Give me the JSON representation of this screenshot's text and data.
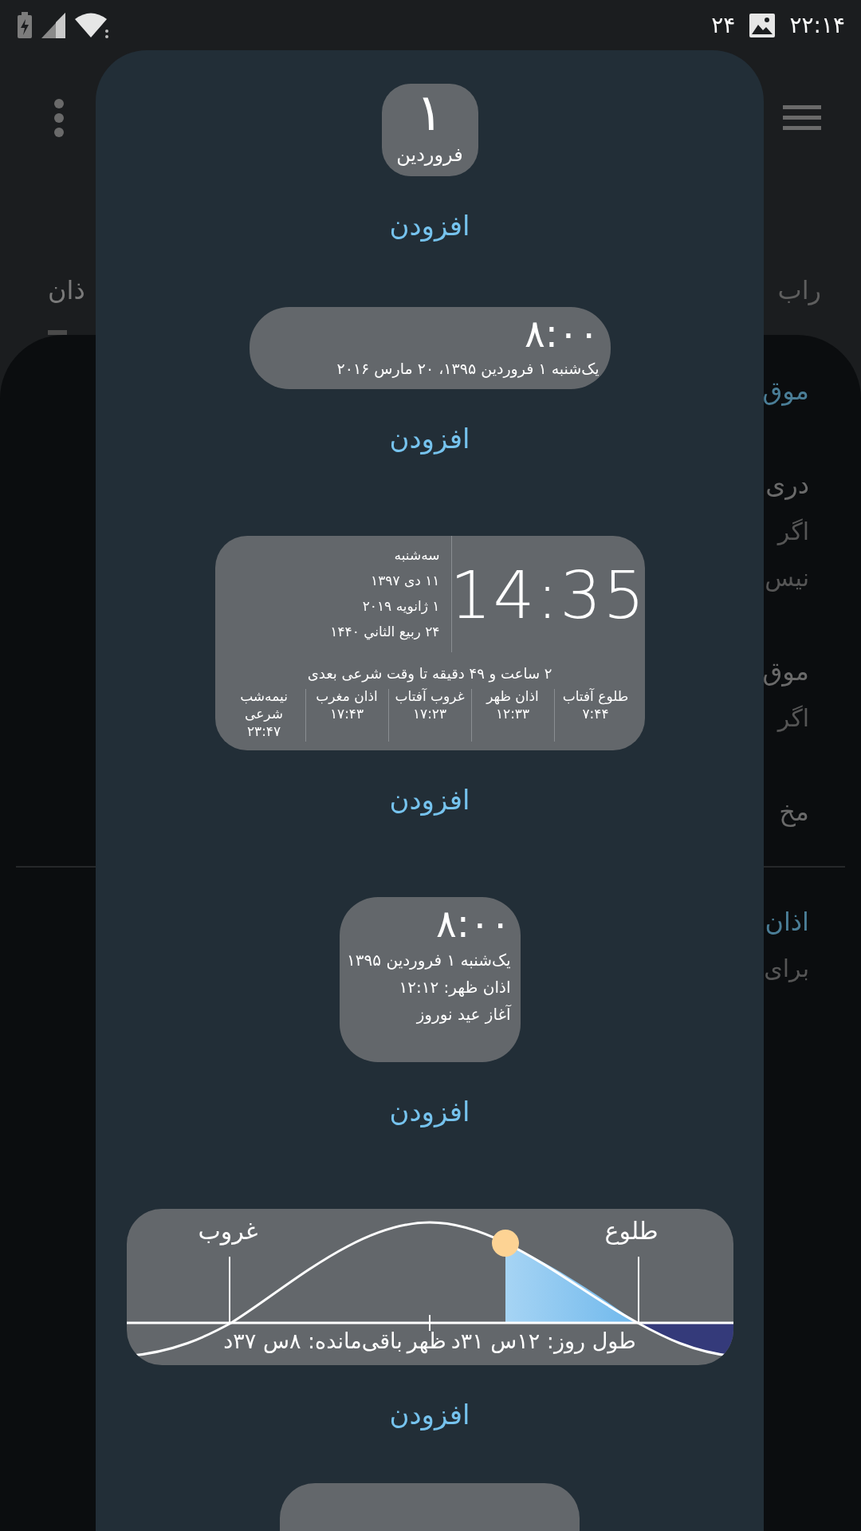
{
  "status_bar": {
    "time": "۲۲:۱۴",
    "date": "۲۴"
  },
  "background": {
    "tabs": [
      {
        "label": "راب",
        "selected": false
      },
      {
        "label": "ذان",
        "selected": true
      }
    ],
    "items": [
      {
        "kind": "heading",
        "text": "موق"
      },
      {
        "kind": "title",
        "text": "دری"
      },
      {
        "kind": "body",
        "text": "اگر"
      },
      {
        "kind": "body",
        "text": "نیس"
      },
      {
        "kind": "title",
        "text": "موق"
      },
      {
        "kind": "body",
        "text": "اگر"
      },
      {
        "kind": "title",
        "text": "مخ"
      },
      {
        "kind": "divider"
      },
      {
        "kind": "heading",
        "text": "اذان"
      },
      {
        "kind": "body",
        "text": "برای"
      }
    ]
  },
  "widgets": [
    {
      "kind": "day",
      "day": "۱",
      "month": "فروردین",
      "add_label": "افزودن"
    },
    {
      "kind": "wide",
      "time": "۸:۰۰",
      "date": "یک‌شنبه ۱ فروردین ۱۳۹۵، ۲۰ مارس ۲۰۱۶",
      "add_label": "افزودن"
    },
    {
      "kind": "clock",
      "time": "14:35",
      "date_lines": [
        "سه‌شنبه",
        "۱۱ دی ۱۳۹۷",
        "۱ ژانویه ۲۰۱۹",
        "۲۴ ربيع الثاني ۱۴۴۰"
      ],
      "countdown": "۲ ساعت و ۴۹ دقیقه تا وقت شرعی بعدی",
      "prayer_times": [
        {
          "name": "طلوع آفتاب",
          "time": "۷:۴۴"
        },
        {
          "name": "اذان ظهر",
          "time": "۱۲:۳۳"
        },
        {
          "name": "غروب آفتاب",
          "time": "۱۷:۲۳"
        },
        {
          "name": "اذان مغرب",
          "time": "۱۷:۴۳"
        },
        {
          "name": "نیمه‌شب شرعی",
          "time": "۲۳:۴۷"
        }
      ],
      "add_label": "افزودن"
    },
    {
      "kind": "square",
      "time": "۸:۰۰",
      "lines": [
        "یک‌شنبه ۱ فروردین ۱۳۹۵",
        "اذان ظهر: ۱۲:۱۲",
        "آغاز عید نوروز"
      ],
      "add_label": "افزودن"
    },
    {
      "kind": "sun",
      "sunset_label": "غروب",
      "sunrise_label": "طلوع",
      "day_length": "طول روز: ۱۲س ۳۱د",
      "noon_label": "ظهر",
      "remaining": "باقی‌مانده: ۸س ۳۷د",
      "add_label": "افزودن"
    },
    {
      "kind": "partial"
    }
  ]
}
